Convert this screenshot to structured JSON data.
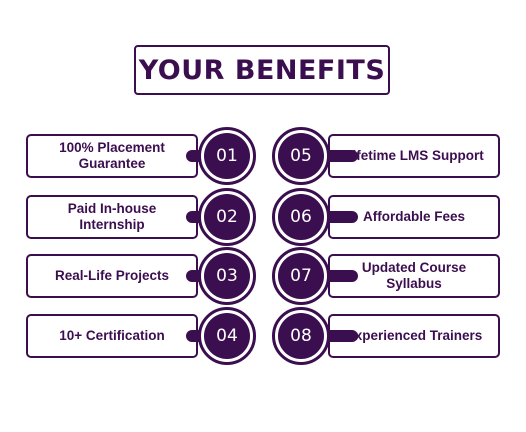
{
  "title": "YOUR BENEFITS",
  "colors": {
    "primary": "#3b0e4f",
    "background": "#ffffff"
  },
  "benefits": [
    {
      "number": "01",
      "label": "100% Placement Guarantee"
    },
    {
      "number": "02",
      "label": "Paid In-house Internship"
    },
    {
      "number": "03",
      "label": "Real-Life Projects"
    },
    {
      "number": "04",
      "label": "10+ Certification"
    },
    {
      "number": "05",
      "label": "Lifetime LMS Support"
    },
    {
      "number": "06",
      "label": "Affordable Fees"
    },
    {
      "number": "07",
      "label": "Updated Course Syllabus"
    },
    {
      "number": "08",
      "label": "Experienced Trainers"
    }
  ]
}
